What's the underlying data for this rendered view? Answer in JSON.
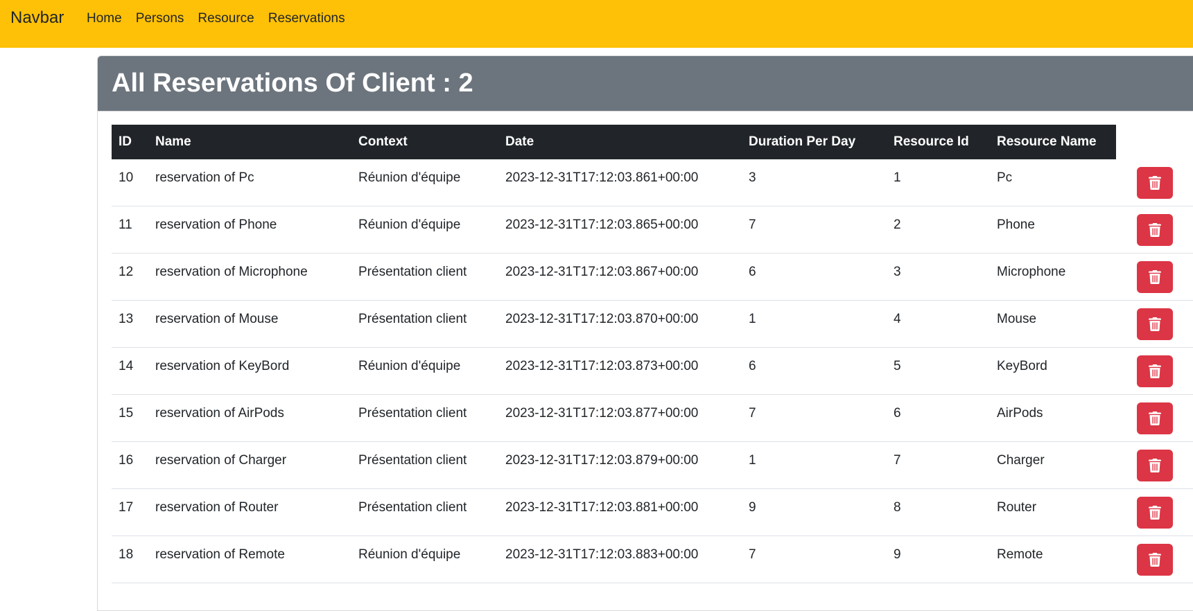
{
  "navbar": {
    "brand": "Navbar",
    "links": [
      "Home",
      "Persons",
      "Resource",
      "Reservations"
    ],
    "color": "#ffc107"
  },
  "header": {
    "title": "All Reservations Of Client : 2",
    "color": "#6c757d"
  },
  "table": {
    "columns": [
      "ID",
      "Name",
      "Context",
      "Date",
      "Duration Per Day",
      "Resource Id",
      "Resource Name"
    ],
    "rows": [
      {
        "id": "10",
        "name": "reservation of Pc",
        "context": "Réunion d'équipe",
        "date": "2023-12-31T17:12:03.861+00:00",
        "duration": "3",
        "resource_id": "1",
        "resource_name": "Pc"
      },
      {
        "id": "11",
        "name": "reservation of Phone",
        "context": "Réunion d'équipe",
        "date": "2023-12-31T17:12:03.865+00:00",
        "duration": "7",
        "resource_id": "2",
        "resource_name": "Phone"
      },
      {
        "id": "12",
        "name": "reservation of Microphone",
        "context": "Présentation client",
        "date": "2023-12-31T17:12:03.867+00:00",
        "duration": "6",
        "resource_id": "3",
        "resource_name": "Microphone"
      },
      {
        "id": "13",
        "name": "reservation of Mouse",
        "context": "Présentation client",
        "date": "2023-12-31T17:12:03.870+00:00",
        "duration": "1",
        "resource_id": "4",
        "resource_name": "Mouse"
      },
      {
        "id": "14",
        "name": "reservation of KeyBord",
        "context": "Réunion d'équipe",
        "date": "2023-12-31T17:12:03.873+00:00",
        "duration": "6",
        "resource_id": "5",
        "resource_name": "KeyBord"
      },
      {
        "id": "15",
        "name": "reservation of AirPods",
        "context": "Présentation client",
        "date": "2023-12-31T17:12:03.877+00:00",
        "duration": "7",
        "resource_id": "6",
        "resource_name": "AirPods"
      },
      {
        "id": "16",
        "name": "reservation of Charger",
        "context": "Présentation client",
        "date": "2023-12-31T17:12:03.879+00:00",
        "duration": "1",
        "resource_id": "7",
        "resource_name": "Charger"
      },
      {
        "id": "17",
        "name": "reservation of Router",
        "context": "Présentation client",
        "date": "2023-12-31T17:12:03.881+00:00",
        "duration": "9",
        "resource_id": "8",
        "resource_name": "Router"
      },
      {
        "id": "18",
        "name": "reservation of Remote",
        "context": "Réunion d'équipe",
        "date": "2023-12-31T17:12:03.883+00:00",
        "duration": "7",
        "resource_id": "9",
        "resource_name": "Remote"
      }
    ]
  },
  "actions": {
    "delete_icon": "trash-icon",
    "delete_color": "#dc3545"
  }
}
